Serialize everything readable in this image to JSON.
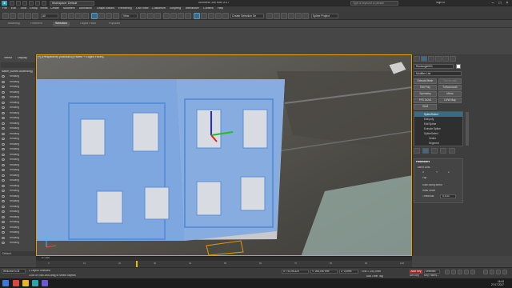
{
  "window": {
    "logo": "3",
    "workspace": "Workspace: Default",
    "title": "Autodesk 3ds Max 2017",
    "search_placeholder": "Type a keyword or phrase",
    "sign_in": "Sign In"
  },
  "menus": [
    "File",
    "Edit",
    "Tools",
    "Group",
    "Views",
    "Create",
    "Modifiers",
    "Animation",
    "Graph Editors",
    "Rendering",
    "Civil View",
    "Customize",
    "Scripting",
    "Interactive",
    "Content",
    "Help"
  ],
  "toolbar": {
    "filter": "All",
    "view": "View",
    "selection_set": "Create Selection Se",
    "spline_project": "Spline Project"
  },
  "ribbon_tabs": [
    "Modeling",
    "Freeform",
    "Selection",
    "Object Paint",
    "Populate"
  ],
  "ribbon_active": "Selection",
  "explorer": {
    "tabs": [
      "Select",
      "Display"
    ],
    "header": "Name (Sorted Ascending)",
    "rows": [
      "Rectang",
      "Rectang",
      "Rectang",
      "Rectang",
      "Rectang",
      "Rectang",
      "Rectang",
      "Rectang",
      "Rectang",
      "Rectang",
      "Rectang",
      "Rectang",
      "Rectang",
      "Rectang",
      "Rectang",
      "Rectang",
      "Rectang",
      "Rectang",
      "Rectang",
      "Rectang",
      "Rectang",
      "Rectang",
      "Rectang",
      "Rectang",
      "Rectang",
      "Rectang",
      "Rectang",
      "Rectang",
      "Rectang",
      "Rectang",
      "Rectang",
      "Rectang",
      "Rectang"
    ],
    "footer": "Default"
  },
  "viewport": {
    "label": "[+] [Perspective] [Standard] [Facets + Edged Faces]",
    "view_cube": "Perspective"
  },
  "command_panel": {
    "object_name": "Rectangle001",
    "modifier_list": "Modifier List",
    "buttons": [
      [
        "Extrude Mesh",
        "Turn to poly"
      ],
      [
        "Edit Poly",
        "Turbosmooth"
      ],
      [
        "Symmetry",
        "Mirror"
      ],
      [
        "FFD 2x2x2",
        "UVW Map"
      ],
      [
        "Shell",
        ""
      ]
    ],
    "stack": [
      "SplineSelect",
      "Edit poly",
      "Edit Spline",
      "Extrude Spline",
      "SplineSelect",
      "Vertex",
      "Segment"
    ],
    "params_title": "Parameters",
    "mirror_axis": "Mirror Axis:",
    "axes": [
      "X",
      "Y",
      "Z"
    ],
    "flip": "Flip",
    "slice_along_mirror": "Slice Along Mirror",
    "weld_seam": "Weld Seam",
    "threshold_label": "Threshold:",
    "threshold_value": "0.1mm"
  },
  "timeline": {
    "frame": "0 / 100",
    "ticks": [
      "0",
      "10",
      "20",
      "30",
      "40",
      "50",
      "60",
      "70",
      "80",
      "90",
      "100"
    ]
  },
  "status": {
    "welcome": "Welcome to M",
    "selected": "1 Object Selected",
    "prompt": "Click or click-and-drag to select objects",
    "x": "X: 751,55,320",
    "y": "Y: 264,000 mm",
    "z": "Z: 0,0mm",
    "grid": "Grid = 100,0mm",
    "add_time_tag": "Add Time Tag",
    "auto_key": "Auto Key",
    "selected_label": "Selected",
    "set_key": "Set Key",
    "key_filters": "Key Filters...",
    "clock_time": "16:43",
    "clock_date": "27.07.2017"
  },
  "colors": {
    "accent": "#3d6a86",
    "viewport_border": "#e5a000",
    "building": "#7ea6df",
    "auto_key": "#a31f1f"
  }
}
